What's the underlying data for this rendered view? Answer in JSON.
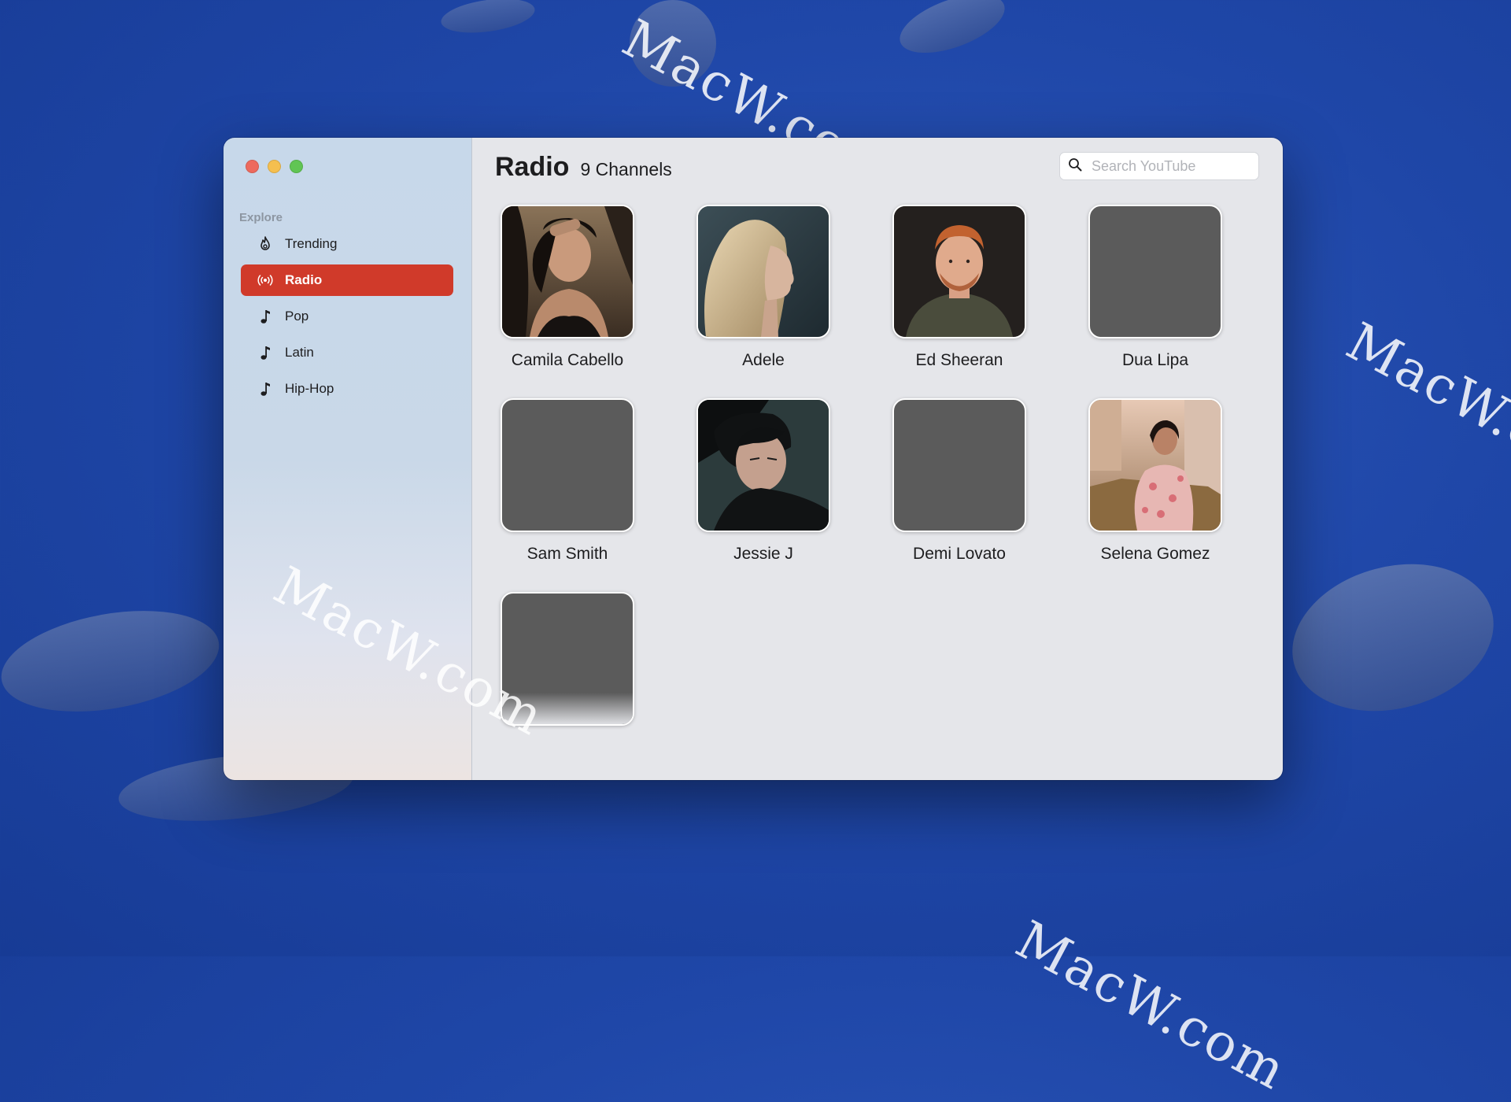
{
  "window": {
    "traffic_lights": {
      "close_color": "#ed6a5e",
      "minimize_color": "#f5bf4f",
      "zoom_color": "#61c554"
    }
  },
  "sidebar": {
    "section_title": "Explore",
    "items": [
      {
        "label": "Trending",
        "icon": "flame-icon",
        "active": false
      },
      {
        "label": "Radio",
        "icon": "radio-broadcast-icon",
        "active": true
      },
      {
        "label": "Pop",
        "icon": "music-note-icon",
        "active": false
      },
      {
        "label": "Latin",
        "icon": "music-note-icon",
        "active": false
      },
      {
        "label": "Hip-Hop",
        "icon": "music-note-icon",
        "active": false
      }
    ],
    "accent_color": "#d03a2a"
  },
  "header": {
    "title": "Radio",
    "count": "9 Channels"
  },
  "search": {
    "placeholder": "Search YouTube",
    "value": ""
  },
  "channels": [
    {
      "name": "Camila Cabello",
      "has_photo": true
    },
    {
      "name": "Adele",
      "has_photo": true
    },
    {
      "name": "Ed Sheeran",
      "has_photo": true
    },
    {
      "name": "Dua Lipa",
      "has_photo": false
    },
    {
      "name": "Sam Smith",
      "has_photo": false
    },
    {
      "name": "Jessie J",
      "has_photo": true
    },
    {
      "name": "Demi Lovato",
      "has_photo": false
    },
    {
      "name": "Selena Gomez",
      "has_photo": true
    },
    {
      "name": "",
      "has_photo": false
    }
  ],
  "watermark": "MacW.com"
}
